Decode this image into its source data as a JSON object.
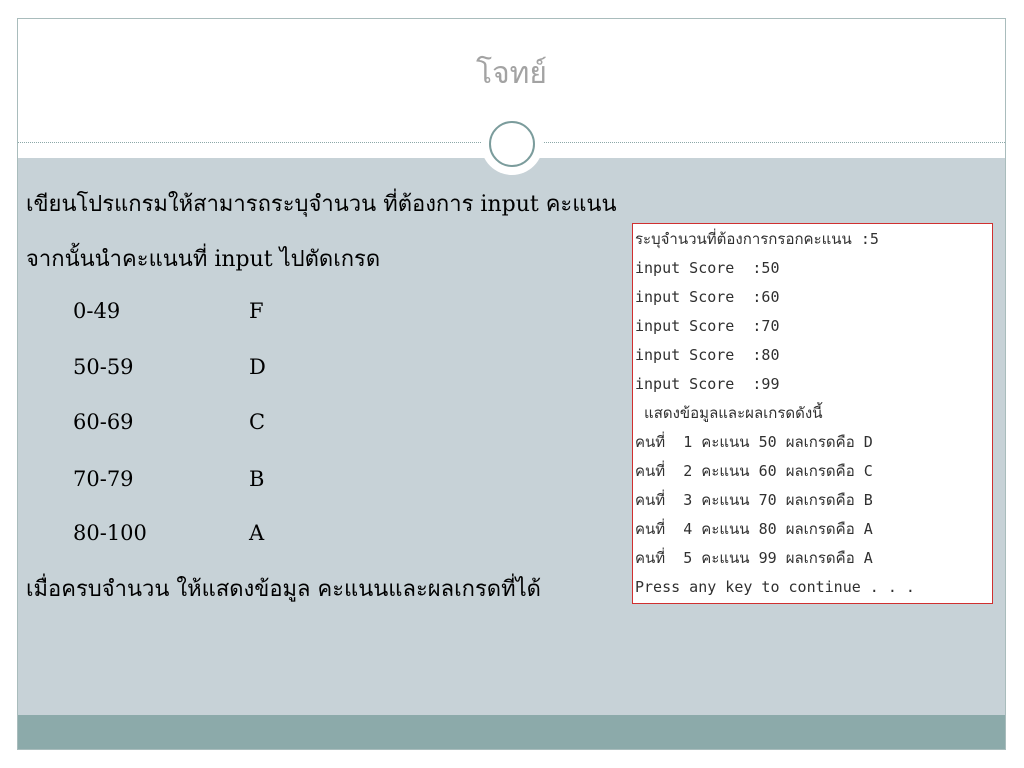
{
  "slide": {
    "title": "โจทย์",
    "lines": [
      "เขียนโปรแกรมให้สามารถระบุจำนวน ที่ต้องการ input คะแนน",
      "จากนั้นนำคะแนนที่ input ไปตัดเกรด"
    ],
    "grades": [
      {
        "range": "0-49",
        "grade": "F"
      },
      {
        "range": "50-59",
        "grade": "D"
      },
      {
        "range": "60-69",
        "grade": "C"
      },
      {
        "range": "70-79",
        "grade": "B"
      },
      {
        "range": "80-100",
        "grade": "A"
      }
    ],
    "closing": "เมื่อครบจำนวน ให้แสดงข้อมูล คะแนนและผลเกรดที่ได้"
  },
  "console": {
    "lines": [
      "ระบุจำนวนที่ต้องการกรอกคะแนน :5",
      "input Score  :50",
      "input Score  :60",
      "input Score  :70",
      "input Score  :80",
      "input Score  :99",
      " แสดงข้อมูลและผลเกรดดังนี้",
      "คนที่  1 คะแนน 50 ผลเกรดคือ D",
      "คนที่  2 คะแนน 60 ผลเกรดคือ C",
      "คนที่  3 คะแนน 70 ผลเกรดคือ B",
      "คนที่  4 คะแนน 80 ผลเกรดคือ A",
      "คนที่  5 คะแนน 99 ผลเกรดคือ A",
      "Press any key to continue . . ."
    ]
  },
  "colors": {
    "title_text": "#a3a3a3",
    "body_background": "#c7d2d7",
    "footer_bar": "#8caaaa",
    "console_border": "#d03030"
  }
}
